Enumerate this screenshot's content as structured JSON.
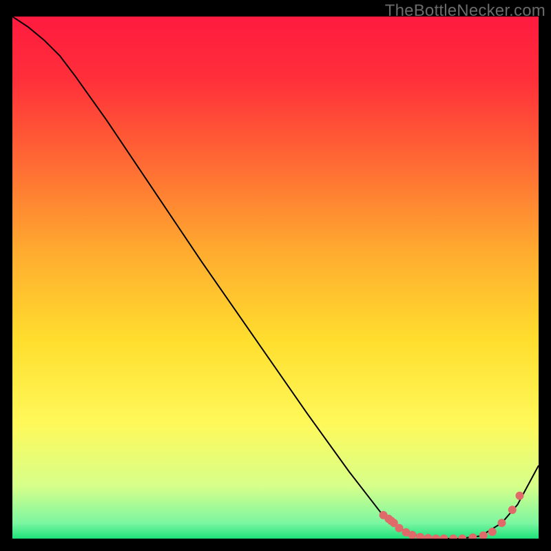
{
  "watermark": "TheBottleNecker.com",
  "chart_data": {
    "type": "line",
    "title": "",
    "xlabel": "",
    "ylabel": "",
    "xlim": [
      0,
      1
    ],
    "ylim": [
      0,
      1
    ],
    "grid": false,
    "legend": false,
    "background_gradient": {
      "stops": [
        {
          "offset": 0.0,
          "color": "#ff1a3f"
        },
        {
          "offset": 0.12,
          "color": "#ff2f3a"
        },
        {
          "offset": 0.28,
          "color": "#ff6a34"
        },
        {
          "offset": 0.45,
          "color": "#ffab2f"
        },
        {
          "offset": 0.62,
          "color": "#ffde2e"
        },
        {
          "offset": 0.78,
          "color": "#fff95a"
        },
        {
          "offset": 0.9,
          "color": "#d6ff8a"
        },
        {
          "offset": 0.97,
          "color": "#7cf6a1"
        },
        {
          "offset": 1.0,
          "color": "#1ee27a"
        }
      ]
    },
    "series": [
      {
        "name": "main-curve",
        "color": "#000000",
        "stroke_width": 2,
        "x": [
          0.0,
          0.03,
          0.06,
          0.09,
          0.12,
          0.18,
          0.26,
          0.36,
          0.46,
          0.56,
          0.64,
          0.7,
          0.735,
          0.77,
          0.81,
          0.85,
          0.89,
          0.93,
          0.96,
          1.0
        ],
        "y": [
          1.0,
          0.98,
          0.955,
          0.925,
          0.885,
          0.8,
          0.68,
          0.53,
          0.385,
          0.24,
          0.128,
          0.05,
          0.02,
          0.005,
          0.0,
          0.0,
          0.005,
          0.03,
          0.065,
          0.14
        ]
      }
    ],
    "points": {
      "name": "cluster-dots",
      "color": "#e06a6a",
      "radius": 6,
      "x": [
        0.705,
        0.715,
        0.72,
        0.725,
        0.735,
        0.748,
        0.76,
        0.775,
        0.79,
        0.805,
        0.82,
        0.838,
        0.855,
        0.875,
        0.895,
        0.912,
        0.93,
        0.95,
        0.964
      ],
      "y": [
        0.045,
        0.038,
        0.034,
        0.03,
        0.02,
        0.012,
        0.007,
        0.003,
        0.001,
        0.0,
        0.0,
        0.0,
        0.0,
        0.002,
        0.006,
        0.013,
        0.03,
        0.055,
        0.082
      ]
    }
  }
}
